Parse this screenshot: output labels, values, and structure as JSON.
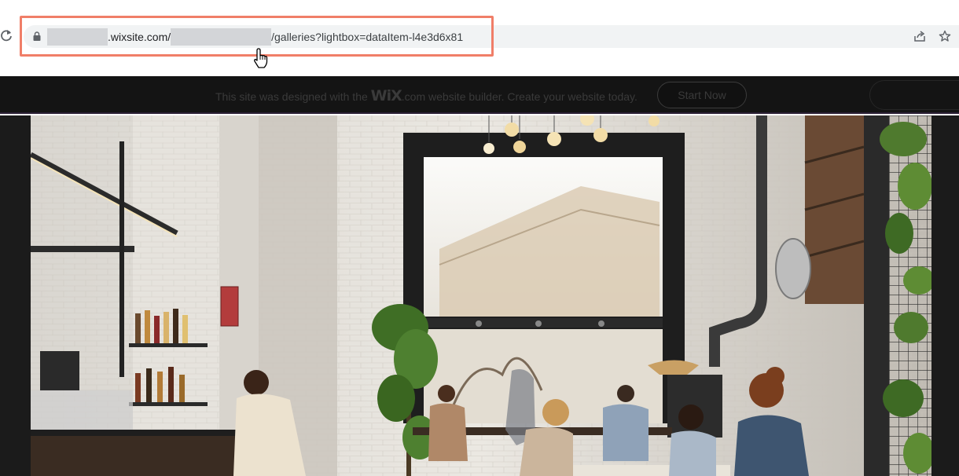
{
  "browser": {
    "url_domain": ".wixsite.com/",
    "url_path": "/galleries?lightbox=dataItem-l4e3d6x81"
  },
  "wix_banner": {
    "text_before": "This site was designed with the ",
    "logo": "WiX",
    "text_after": ".com website builder. Create your website today.",
    "cta_label": "Start Now"
  },
  "icons": {
    "reload": "reload-icon",
    "lock": "lock-icon",
    "share": "share-icon",
    "bookmark": "star-icon",
    "cursor": "hand-pointer-icon"
  },
  "colors": {
    "highlight": "#f07e68",
    "banner_bg": "#141414",
    "omnibox_bg": "#f1f3f4"
  }
}
